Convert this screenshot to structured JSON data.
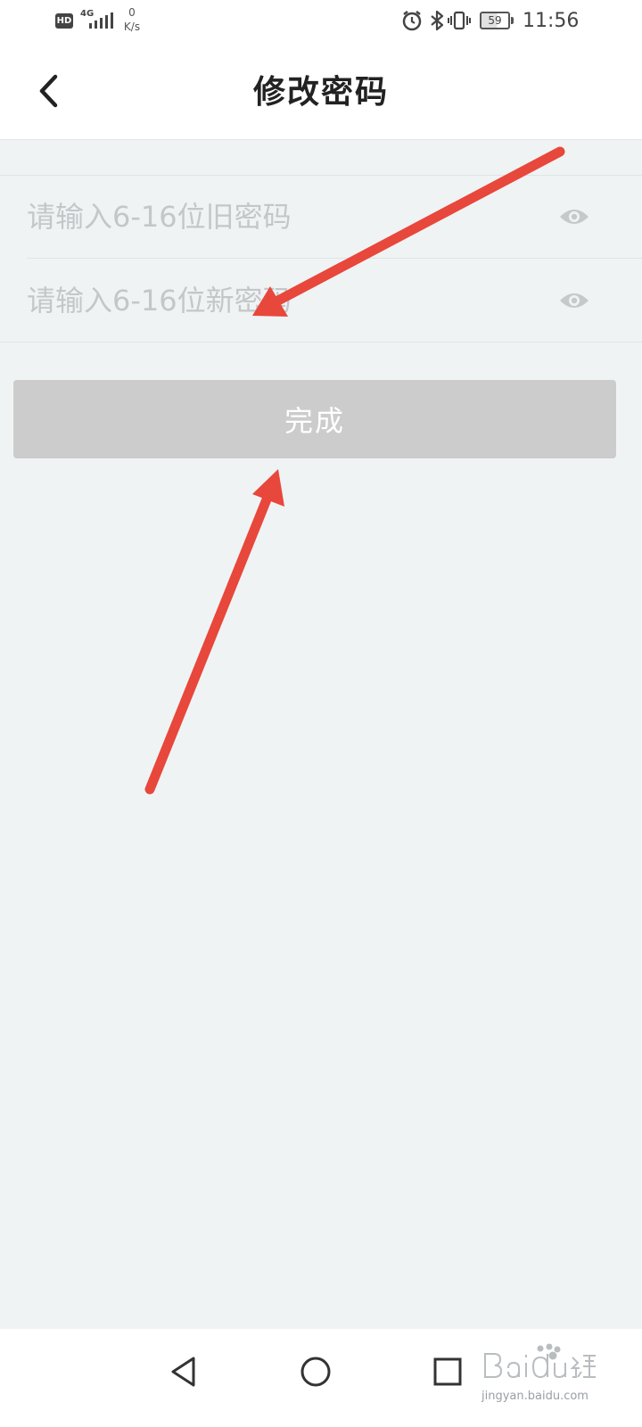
{
  "status_bar": {
    "hd_label": "HD",
    "network_label": "4G",
    "speed_value": "0",
    "speed_unit": "K/s",
    "battery_level": "59",
    "time": "11:56",
    "icons": [
      "alarm-icon",
      "bluetooth-icon",
      "vibrate-icon",
      "battery-icon"
    ]
  },
  "header": {
    "title": "修改密码",
    "back_icon": "chevron-left-icon"
  },
  "form": {
    "old_password": {
      "placeholder": "请输入6-16位旧密码",
      "value": "",
      "visibility_icon": "eye-icon"
    },
    "new_password": {
      "placeholder": "请输入6-16位新密码",
      "value": "",
      "visibility_icon": "eye-icon"
    }
  },
  "actions": {
    "done_label": "完成",
    "done_color": "#cccccc"
  },
  "annotations": {
    "arrow_color": "#e8473b",
    "icons": [
      "arrow-annotation"
    ]
  },
  "nav_bar": {
    "icons": [
      "back-triangle-icon",
      "home-circle-icon",
      "recent-square-icon"
    ]
  },
  "watermark": {
    "text": "jingyan.baidu.com"
  }
}
